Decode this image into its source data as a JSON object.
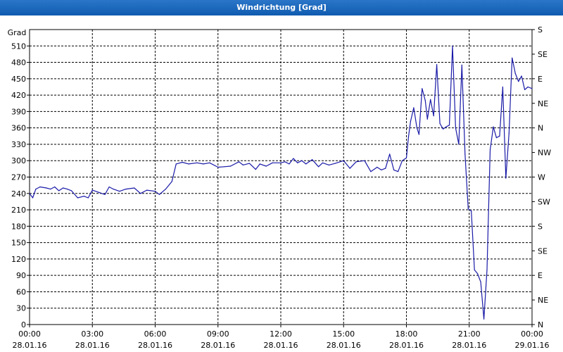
{
  "window": {
    "title": "Windrichtung [Grad]"
  },
  "chart_data": {
    "type": "line",
    "title": "Windrichtung [Grad]",
    "ylabel": "Grad",
    "ylim": [
      0,
      540
    ],
    "grid": true,
    "line_color": "#1a1aa8",
    "left_ticks": [
      0,
      30,
      60,
      90,
      120,
      150,
      180,
      210,
      240,
      270,
      300,
      330,
      360,
      390,
      420,
      450,
      480,
      510
    ],
    "right_ticks": [
      {
        "value": 0,
        "label": "N"
      },
      {
        "value": 45,
        "label": "NE"
      },
      {
        "value": 90,
        "label": "E"
      },
      {
        "value": 135,
        "label": "SE"
      },
      {
        "value": 180,
        "label": "S"
      },
      {
        "value": 225,
        "label": "SW"
      },
      {
        "value": 270,
        "label": "W"
      },
      {
        "value": 315,
        "label": "NW"
      },
      {
        "value": 360,
        "label": "N"
      },
      {
        "value": 405,
        "label": "NE"
      },
      {
        "value": 450,
        "label": "E"
      },
      {
        "value": 495,
        "label": "SE"
      },
      {
        "value": 540,
        "label": "S"
      }
    ],
    "x_ticks": [
      {
        "time": "00:00",
        "date": "28.01.16"
      },
      {
        "time": "03:00",
        "date": "28.01.16"
      },
      {
        "time": "06:00",
        "date": "28.01.16"
      },
      {
        "time": "09:00",
        "date": "28.01.16"
      },
      {
        "time": "12:00",
        "date": "28.01.16"
      },
      {
        "time": "15:00",
        "date": "28.01.16"
      },
      {
        "time": "18:00",
        "date": "28.01.16"
      },
      {
        "time": "21:00",
        "date": "28.01.16"
      },
      {
        "time": "00:00",
        "date": "29.01.16"
      }
    ],
    "x_hours_range": [
      0,
      24
    ],
    "series": [
      {
        "x": [
          0,
          0.15,
          0.3,
          0.5,
          0.8,
          1.0,
          1.2,
          1.4,
          1.6,
          1.8,
          2.0,
          2.3,
          2.6,
          2.8,
          3.0,
          3.3,
          3.6,
          3.8,
          4.0,
          4.3,
          4.6,
          5.0,
          5.3,
          5.6,
          6.0,
          6.2,
          6.5,
          6.8,
          7.0,
          7.3,
          7.6,
          8.0,
          8.3,
          8.6,
          9.0,
          9.3,
          9.6,
          10.0,
          10.2,
          10.5,
          10.8,
          11.0,
          11.3,
          11.6,
          12.0,
          12.2,
          12.4,
          12.6,
          12.8,
          13.0,
          13.2,
          13.5,
          13.8,
          14.0,
          14.3,
          14.6,
          15.0,
          15.3,
          15.6,
          16.0,
          16.3,
          16.6,
          16.8,
          17.0,
          17.2,
          17.4,
          17.6,
          17.8,
          18.0,
          18.1,
          18.2,
          18.35,
          18.5,
          18.6,
          18.75,
          18.9,
          19.0,
          19.15,
          19.3,
          19.45,
          19.6,
          19.75,
          19.9,
          20.05,
          20.2,
          20.35,
          20.5,
          20.65,
          20.8,
          20.95,
          21.1,
          21.25,
          21.4,
          21.55,
          21.7,
          21.85,
          22.0,
          22.15,
          22.3,
          22.45,
          22.6,
          22.75,
          22.9,
          23.05,
          23.2,
          23.35,
          23.5,
          23.65,
          23.8,
          24.0
        ],
        "y": [
          240,
          232,
          248,
          252,
          250,
          248,
          252,
          245,
          250,
          248,
          245,
          232,
          235,
          232,
          246,
          242,
          238,
          252,
          248,
          244,
          248,
          250,
          240,
          246,
          244,
          238,
          248,
          262,
          294,
          297,
          294,
          296,
          294,
          296,
          288,
          289,
          290,
          298,
          292,
          295,
          284,
          294,
          290,
          296,
          296,
          298,
          294,
          304,
          296,
          300,
          294,
          302,
          289,
          296,
          292,
          295,
          300,
          286,
          298,
          300,
          280,
          288,
          283,
          286,
          312,
          283,
          280,
          300,
          305,
          344,
          372,
          397,
          360,
          348,
          432,
          410,
          376,
          412,
          382,
          476,
          368,
          358,
          362,
          365,
          510,
          360,
          330,
          475,
          312,
          212,
          208,
          100,
          93,
          78,
          10,
          100,
          320,
          362,
          342,
          345,
          435,
          268,
          350,
          488,
          460,
          445,
          455,
          430,
          435,
          432
        ]
      }
    ]
  }
}
